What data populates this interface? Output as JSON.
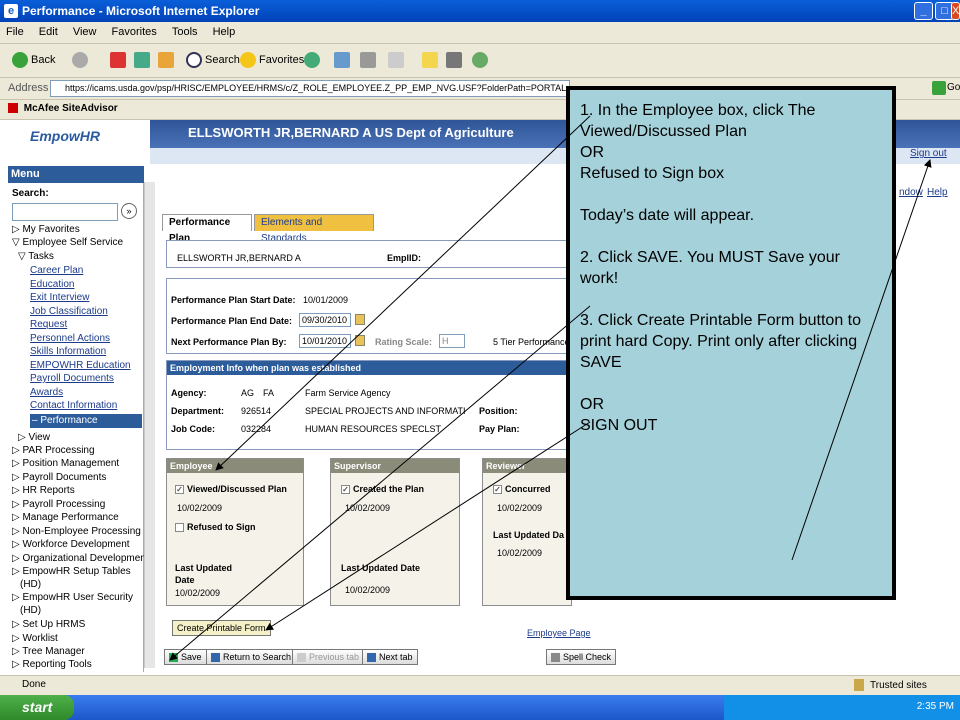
{
  "window": {
    "title": "Performance - Microsoft Internet Explorer"
  },
  "menubar": [
    "File",
    "Edit",
    "View",
    "Favorites",
    "Tools",
    "Help"
  ],
  "toolbar": {
    "back": "Back",
    "search": "Search",
    "favorites": "Favorites"
  },
  "address": {
    "label": "Address",
    "url": "https://icams.usda.gov/psp/HRISC/EMPLOYEE/HRMS/c/Z_ROLE_EMPLOYEE.Z_PP_EMP_NVG.USF?FolderPath=PORTAL_ROOT_OBJECT.CO",
    "go": "Go"
  },
  "links": {
    "mcafee": "McAfee SiteAdvisor"
  },
  "header": {
    "logo": "EmpowHR",
    "banner": "ELLSWORTH JR,BERNARD A  US Dept of Agriculture",
    "sign_out": "Sign out",
    "new_window": "ndow",
    "help": "Help"
  },
  "sidebar": {
    "menu": "Menu",
    "search_label": "Search:",
    "items_top": [
      "My Favorites",
      "Employee Self Service",
      "Tasks"
    ],
    "task_links": [
      "Career Plan",
      "Education",
      "Exit Interview",
      "Job Classification",
      "Request",
      "Personnel Actions",
      "Skills Information",
      "EMPOWHR Education",
      "Payroll Documents",
      "Awards",
      "Contact Information"
    ],
    "active": "Performance",
    "items_bottom": [
      "View",
      "PAR Processing",
      "Position Management",
      "Payroll Documents",
      "HR Reports",
      "Payroll Processing",
      "Manage Performance",
      "Non-Employee Processing",
      "Workforce Development",
      "Organizational Development",
      "EmpowHR Setup Tables",
      "(HD)",
      "EmpowHR User Security",
      "(HD)",
      "Set Up HRMS",
      "Worklist",
      "Tree Manager",
      "Reporting Tools"
    ]
  },
  "tabs": {
    "performance_plan": "Performance Plan",
    "elements": "Elements and Standards"
  },
  "employee_header": {
    "name": "ELLSWORTH JR,BERNARD A",
    "emplid_label": "EmplID:",
    "emplid_value": ""
  },
  "plan": {
    "start_label": "Performance Plan Start Date:",
    "start_value": "10/01/2009",
    "end_label": "Performance Plan End Date:",
    "end_value": "09/30/2010",
    "next_label": "Next Performance Plan By:",
    "next_value": "10/01/2010",
    "rating_label": "Rating Scale:",
    "rating_value": "H",
    "rating_desc": "5 Tier Performance"
  },
  "employment": {
    "heading": "Employment Info when plan was established",
    "agency_label": "Agency:",
    "agency_code": "AG",
    "agency_sub": "FA",
    "agency_name": "Farm Service Agency",
    "dept_label": "Department:",
    "dept_code": "926514",
    "dept_name": "SPECIAL PROJECTS AND INFORMATI",
    "position_label": "Position:",
    "job_label": "Job Code:",
    "job_code": "032284",
    "job_name": "HUMAN RESOURCES SPECLST",
    "payplan_label": "Pay Plan:"
  },
  "employee_panel": {
    "heading": "Employee",
    "viewed": "Viewed/Discussed Plan",
    "viewed_date": "10/02/2009",
    "refused": "Refused to Sign",
    "last_updated": "Last Updated",
    "date_label": "Date",
    "last_date": "10/02/2009"
  },
  "supervisor_panel": {
    "heading": "Supervisor",
    "created": "Created the Plan",
    "created_date": "10/02/2009",
    "last_updated": "Last Updated Date",
    "last_date": "10/02/2009"
  },
  "reviewer_panel": {
    "heading": "Reviewer",
    "concurred": "Concurred",
    "concurred_date": "10/02/2009",
    "last_updated": "Last Updated Da",
    "last_date": "10/02/2009"
  },
  "actions": {
    "create_printable": "Create Printable Form",
    "employee_page": "Employee Page",
    "save": "Save",
    "return": "Return to Search",
    "previous": "Previous tab",
    "next": "Next tab",
    "spell": "Spell Check"
  },
  "status": {
    "done": "Done",
    "zone": "Trusted sites"
  },
  "taskbar": {
    "start": "start",
    "time": "2:35 PM"
  },
  "callout": {
    "text": "1. In the Employee box, click The Viewed/Discussed Plan\nOR\nRefused to Sign box\n\nToday’s date will appear.\n\n2. Click SAVE.  You MUST Save your work!\n\n3. Click Create Printable Form button to print hard Copy. Print only after clicking SAVE\n\nOR\nSIGN OUT"
  }
}
